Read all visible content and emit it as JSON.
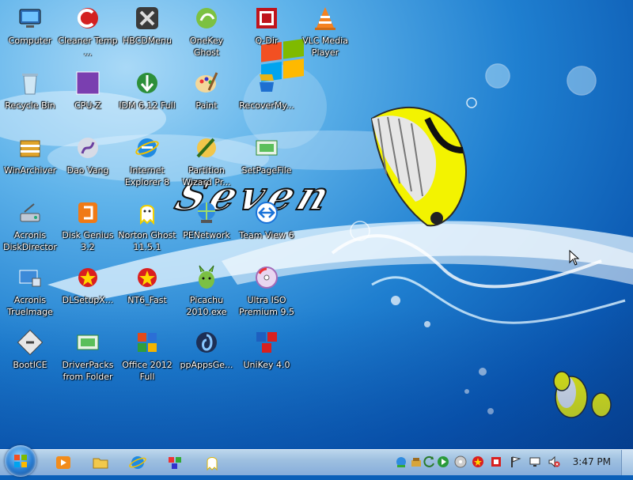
{
  "desktop_icons": [
    {
      "label": "Computer",
      "icon": "computer-icon"
    },
    {
      "label": "Cleaner Temp ...",
      "icon": "ccleaner-icon"
    },
    {
      "label": "HBCDMenu",
      "icon": "tools-icon"
    },
    {
      "label": "OneKey Ghost",
      "icon": "onekey-ghost-icon"
    },
    {
      "label": "Q-Dir",
      "icon": "qdir-icon"
    },
    {
      "label": "VLC Media Player",
      "icon": "vlc-cone-icon"
    },
    {
      "label": "Recycle Bin",
      "icon": "recycle-bin-icon"
    },
    {
      "label": "CPU-Z",
      "icon": "cpuz-icon"
    },
    {
      "label": "IDM 6.12 Full",
      "icon": "idm-icon"
    },
    {
      "label": "Paint",
      "icon": "paint-palette-icon"
    },
    {
      "label": "RecoverMy...",
      "icon": "recovermyfiles-icon"
    },
    {
      "label": "WinArchiver",
      "icon": "archive-icon"
    },
    {
      "label": "Dao Vang",
      "icon": "daovang-icon"
    },
    {
      "label": "Internet Explorer 8",
      "icon": "internet-explorer-icon"
    },
    {
      "label": "Partition Wizard Pr...",
      "icon": "partition-wizard-icon"
    },
    {
      "label": "SetPageFile",
      "icon": "setpagefile-icon"
    },
    {
      "label": "Acronis DiskDirector",
      "icon": "acronis-disk-icon"
    },
    {
      "label": "Disk Genius 3.2",
      "icon": "diskgenius-icon"
    },
    {
      "label": "Norton Ghost 11.5.1",
      "icon": "ghost-icon"
    },
    {
      "label": "PENetwork",
      "icon": "network-icon"
    },
    {
      "label": "Team View 6",
      "icon": "teamviewer-icon"
    },
    {
      "label": "Acronis TrueImage",
      "icon": "acronis-trueimage-icon"
    },
    {
      "label": "DLSetupX...",
      "icon": "vietnam-star-icon"
    },
    {
      "label": "NT6_Fast",
      "icon": "vietnam-star-icon"
    },
    {
      "label": "Picachu 2010.exe",
      "icon": "pikachu-icon"
    },
    {
      "label": "Ultra ISO Premium 9.5",
      "icon": "disc-icon"
    },
    {
      "label": "BootICE",
      "icon": "bootice-icon"
    },
    {
      "label": "DriverPacks from Folder",
      "icon": "driverpacks-icon"
    },
    {
      "label": "Office 2012 Full",
      "icon": "office-icon"
    },
    {
      "label": "ppAppsGe...",
      "icon": "ppapps-icon"
    },
    {
      "label": "UniKey 4.0",
      "icon": "unikey-icon"
    }
  ],
  "wallpaper": {
    "text": "Seven"
  },
  "taskbar": {
    "pinned": [
      {
        "name": "media-player-icon"
      },
      {
        "name": "explorer-folder-icon"
      },
      {
        "name": "internet-explorer-icon"
      },
      {
        "name": "paint-icon"
      },
      {
        "name": "ghost-icon"
      }
    ],
    "tray": [
      {
        "name": "network-tray-icon"
      },
      {
        "name": "tray-app-icon"
      },
      {
        "name": "refresh-tray-icon"
      },
      {
        "name": "play-tray-icon"
      },
      {
        "name": "disc-tray-icon"
      },
      {
        "name": "vietnam-star-tray-icon"
      },
      {
        "name": "unikey-tray-icon"
      },
      {
        "name": "flag-tray-icon"
      },
      {
        "name": "monitor-tray-icon"
      },
      {
        "name": "volume-muted-tray-icon"
      }
    ],
    "clock": "3:47 PM"
  },
  "colors": {
    "taskbar": "#9ec0e0",
    "desktop": "#1f7fd0",
    "accent": "#ffe600"
  }
}
